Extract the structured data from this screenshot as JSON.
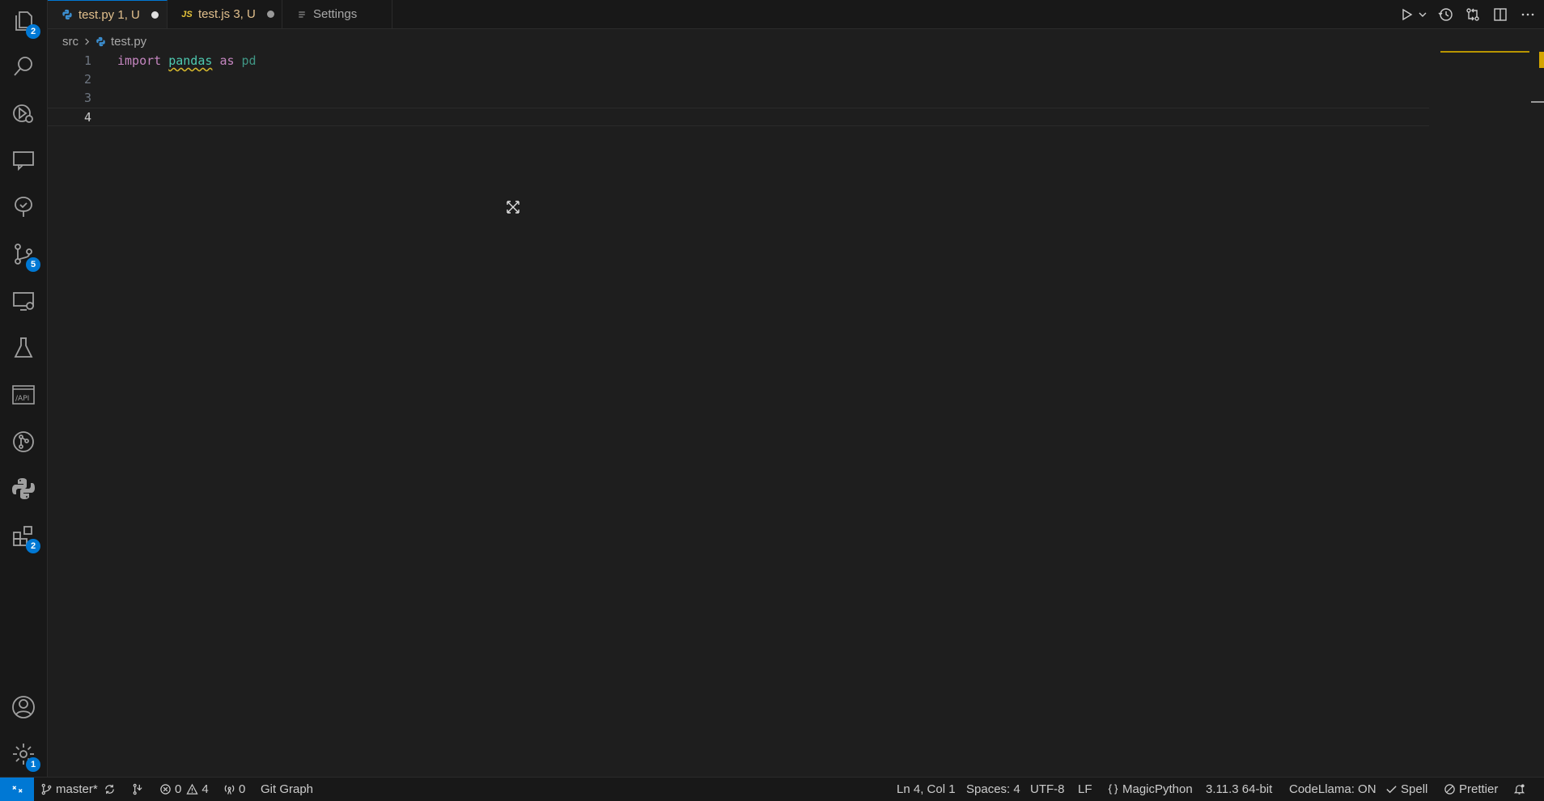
{
  "tabs": [
    {
      "icon": "python-icon",
      "label": "test.py 1, U",
      "color": "#e2c08d",
      "active": true
    },
    {
      "icon": "javascript-icon",
      "icon_text": "JS",
      "label": "test.js 3, U",
      "color": "#e2c08d",
      "active": false
    },
    {
      "icon": "settings-file-icon",
      "label": "Settings",
      "color": "#a9a9a9",
      "active": false
    }
  ],
  "breadcrumb": {
    "folder": "src",
    "file": "test.py"
  },
  "editor": {
    "lines": [
      {
        "number": "1",
        "keyword": "import",
        "module": "pandas",
        "kw2": "as",
        "alias": "pd"
      },
      {
        "number": "2"
      },
      {
        "number": "3"
      },
      {
        "number": "4"
      }
    ]
  },
  "activity_bar": {
    "explorer_badge": "2",
    "source_control_badge": "5",
    "extensions_badge": "2",
    "manage_badge": "1"
  },
  "statusbar": {
    "branch": "master*",
    "errors": "0",
    "warnings": "4",
    "ports": "0",
    "git_graph": "Git Graph",
    "position": "Ln 4, Col 1",
    "spaces": "Spaces: 4",
    "encoding": "UTF-8",
    "eol": "LF",
    "language": "MagicPython",
    "interpreter": "3.11.3 64-bit",
    "codellama": "CodeLlama: ON",
    "spell": "Spell",
    "prettier": "Prettier"
  },
  "colors": {
    "accent": "#0078d4",
    "badge": "#0078d4",
    "warning": "#d7ba2d"
  }
}
